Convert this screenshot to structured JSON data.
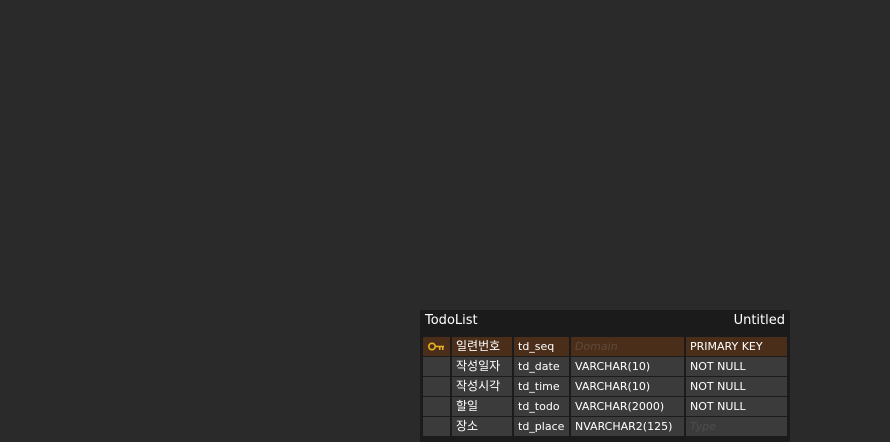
{
  "table": {
    "name": "TodoList",
    "comment": "Untitled",
    "columns": [
      {
        "key_icon": "key-icon",
        "name": "일련번호",
        "physical": "td_seq",
        "domain": "",
        "domain_placeholder": "Domain",
        "option": "PRIMARY KEY",
        "type_placeholder": "Type",
        "primary": true
      },
      {
        "key_icon": "",
        "name": "작성일자",
        "physical": "td_date",
        "domain": "VARCHAR(10)",
        "domain_placeholder": "Domain",
        "option": "NOT NULL",
        "type_placeholder": "Type",
        "primary": false
      },
      {
        "key_icon": "",
        "name": "작성시각",
        "physical": "td_time",
        "domain": "VARCHAR(10)",
        "domain_placeholder": "Domain",
        "option": "NOT NULL",
        "type_placeholder": "Type",
        "primary": false
      },
      {
        "key_icon": "",
        "name": "할일",
        "physical": "td_todo",
        "domain": "VARCHAR(2000)",
        "domain_placeholder": "Domain",
        "option": "NOT NULL",
        "type_placeholder": "Type",
        "primary": false
      },
      {
        "key_icon": "",
        "name": "장소",
        "physical": "td_place",
        "domain": "NVARCHAR2(125)",
        "domain_placeholder": "Domain",
        "option": "",
        "type_placeholder": "Type",
        "primary": false
      }
    ]
  },
  "colors": {
    "canvas": "#2a2a2a",
    "table_bg": "#1b1b1b",
    "cell_bg": "#3b3b3b",
    "pk_row_bg": "#4a2e1a",
    "key_icon": "#e6b422"
  }
}
